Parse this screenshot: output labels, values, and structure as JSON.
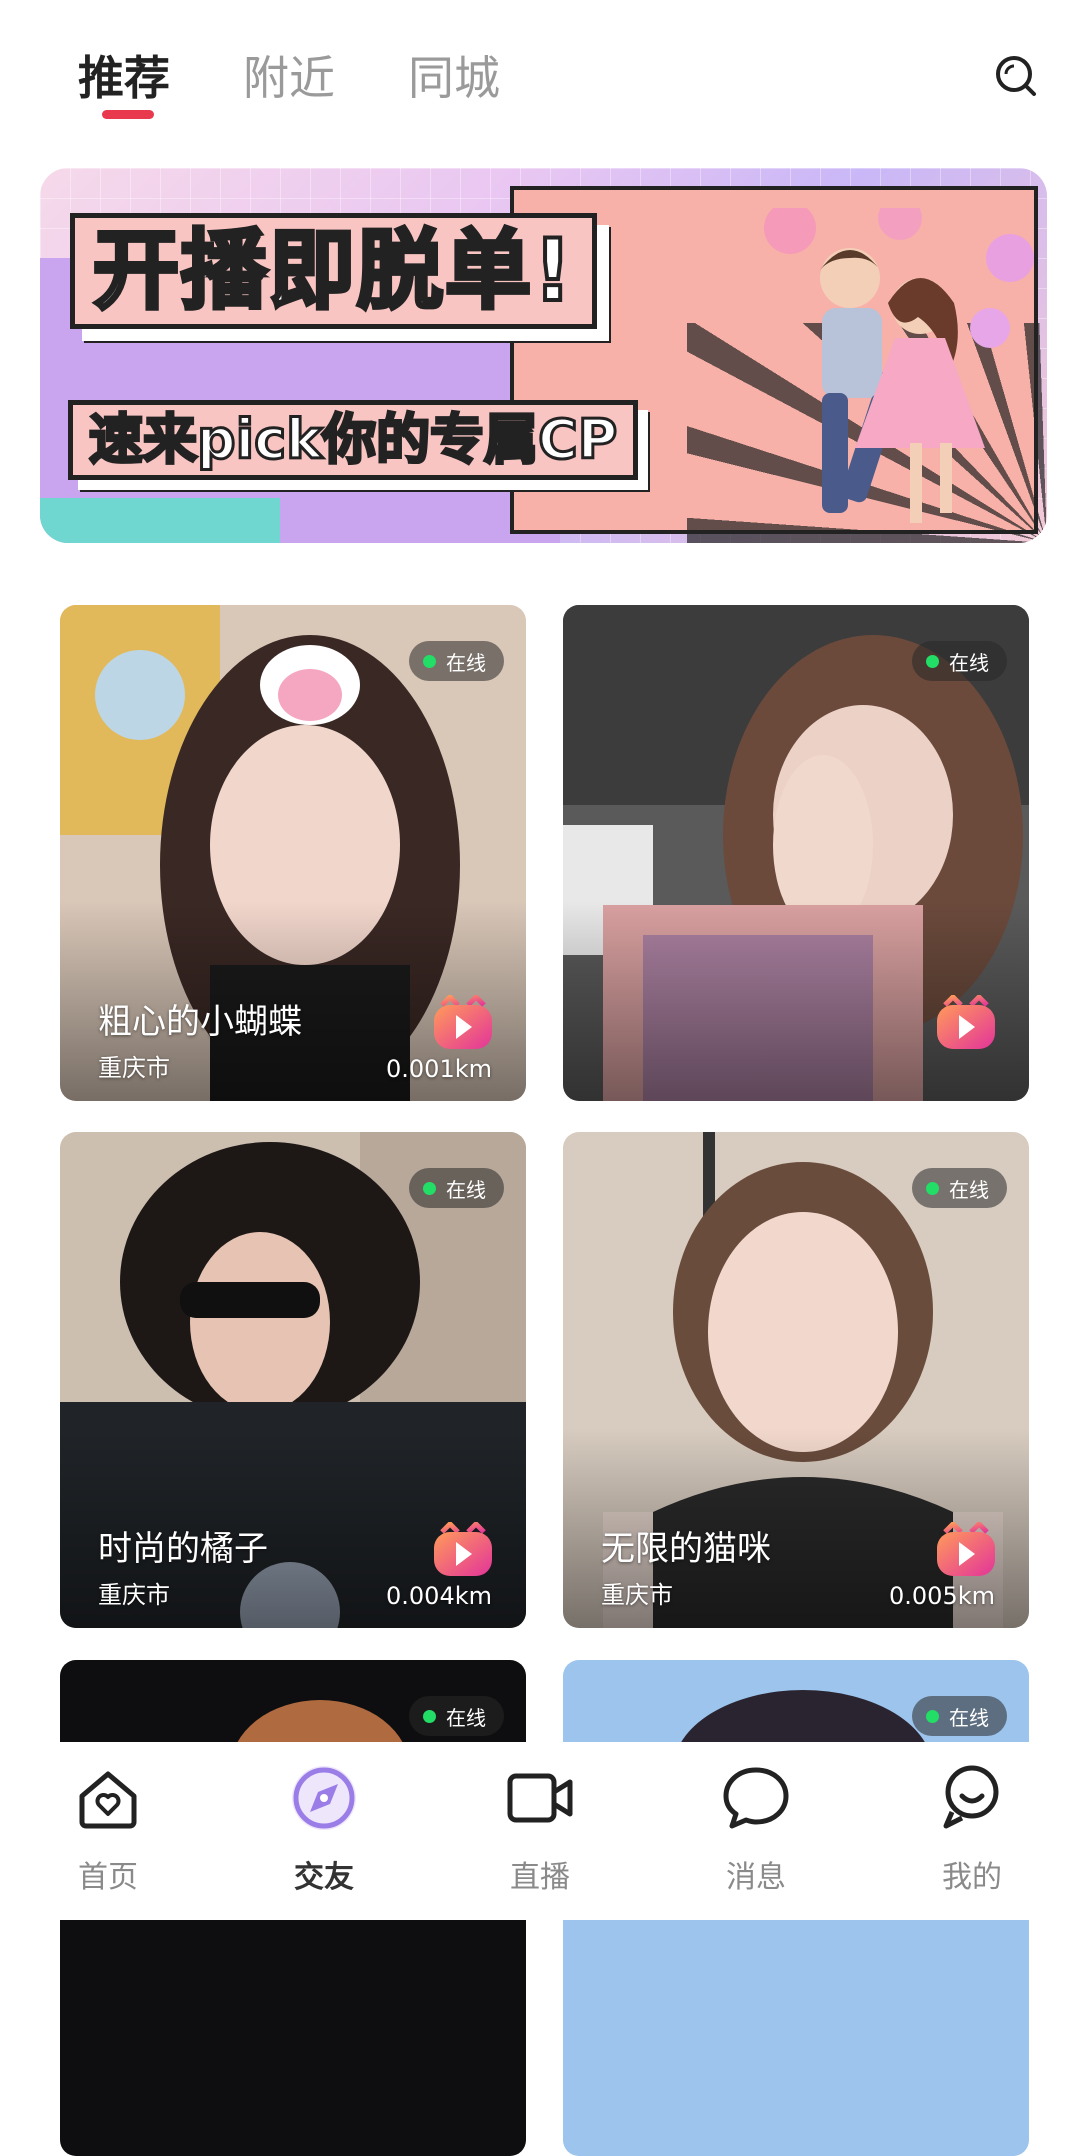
{
  "tabs": [
    {
      "label": "推荐",
      "active": true
    },
    {
      "label": "附近",
      "active": false
    },
    {
      "label": "同城",
      "active": false
    }
  ],
  "search": {
    "icon": "search-icon"
  },
  "banner": {
    "line1": "开播即脱单!",
    "line2": "速来pick你的专属CP"
  },
  "cards": [
    {
      "name": "粗心的小蝴蝶",
      "city": "重庆市",
      "distance": "0.001km",
      "status": "在线"
    },
    {
      "name": "",
      "city": "",
      "distance": "",
      "status": "在线"
    },
    {
      "name": "时尚的橘子",
      "city": "重庆市",
      "distance": "0.004km",
      "status": "在线"
    },
    {
      "name": "无限的猫咪",
      "city": "重庆市",
      "distance": "0.005km",
      "status": "在线"
    },
    {
      "name": "",
      "city": "",
      "distance": "",
      "status": "在线"
    },
    {
      "name": "",
      "city": "",
      "distance": "",
      "status": "在线"
    }
  ],
  "nav": [
    {
      "label": "首页",
      "icon": "home-icon"
    },
    {
      "label": "交友",
      "icon": "compass-icon",
      "active": true
    },
    {
      "label": "直播",
      "icon": "video-camera-icon"
    },
    {
      "label": "消息",
      "icon": "message-bubble-icon"
    },
    {
      "label": "我的",
      "icon": "profile-icon"
    }
  ],
  "colors": {
    "accent": "#e8394f",
    "online": "#22dd66",
    "nav_active": "#9b7de8"
  }
}
